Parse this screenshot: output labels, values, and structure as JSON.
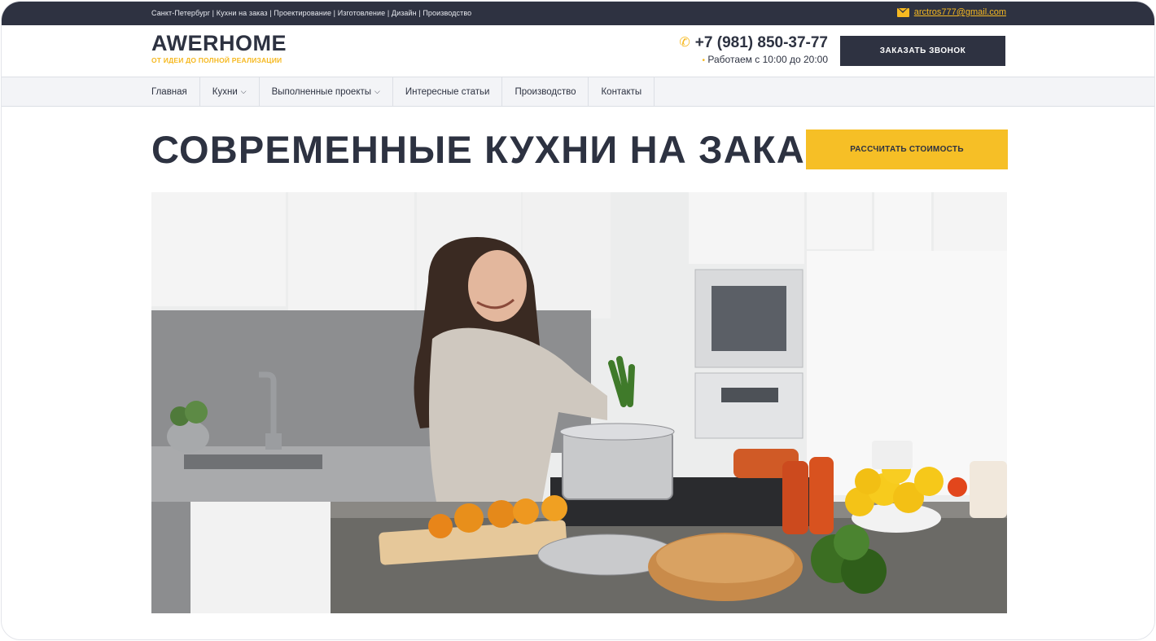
{
  "topbar": {
    "breadcrumbs": "Санкт-Петербург | Кухни на заказ | Проектирование | Изготовление | Дизайн | Производство",
    "email": "arctros777@gmail.com"
  },
  "header": {
    "logo": "AWERHOME",
    "tagline": "ОТ ИДЕИ ДО ПОЛНОЙ РЕАЛИЗАЦИИ",
    "phone": "+7 (981) 850-37-77",
    "hours": "Работаем с 10:00 до 20:00",
    "callback_label": "ЗАКАЗАТЬ  ЗВОНОК"
  },
  "nav": {
    "items": [
      {
        "label": "Главная",
        "dropdown": false
      },
      {
        "label": "Кухни",
        "dropdown": true
      },
      {
        "label": "Выполненные проекты",
        "dropdown": true
      },
      {
        "label": "Интересные статьи",
        "dropdown": false
      },
      {
        "label": "Производство",
        "dropdown": false
      },
      {
        "label": "Контакты",
        "dropdown": false
      }
    ]
  },
  "hero": {
    "title": "СОВРЕМЕННЫЕ КУХНИ НА ЗАКАЗ",
    "cta_label": "РАССЧИТАТЬ СТОИМОСТЬ"
  },
  "colors": {
    "dark": "#2e3241",
    "accent": "#f6bf26",
    "nav_bg": "#f3f4f7"
  },
  "icons": [
    "mail-icon",
    "phone-icon",
    "chevron-down-icon"
  ]
}
